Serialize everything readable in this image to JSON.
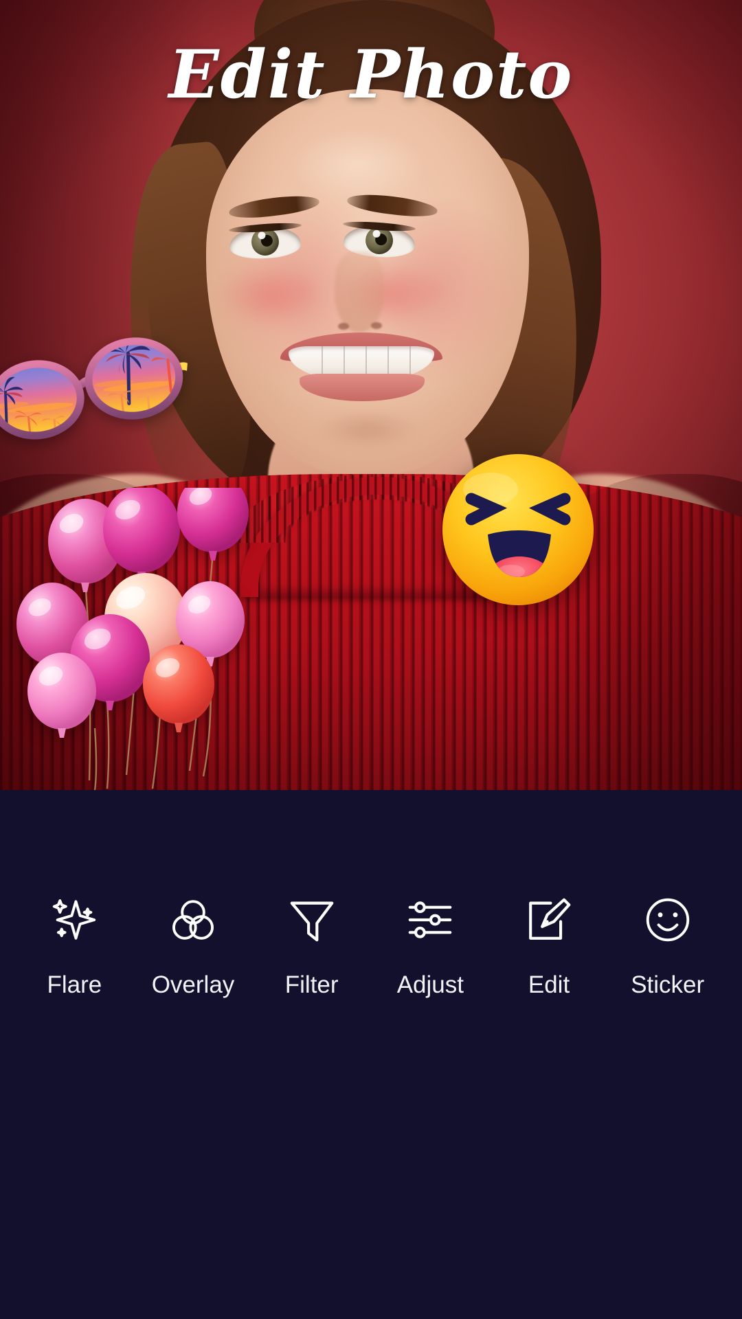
{
  "app": {
    "title": "Edit Photo",
    "background_color": "#12102c",
    "photo_backdrop_color": "#b33c40",
    "accent_color": "#ffffff"
  },
  "photo": {
    "description": "Smiling young woman with brown hair wearing a red ribbed knit sweater on a red studio backdrop",
    "stickers": [
      {
        "name": "sunglasses-sticker",
        "label": "Sunglasses",
        "type": "sunglasses",
        "position": "left"
      },
      {
        "name": "emoji-sticker",
        "label": "Laughing Emoji",
        "type": "emoji",
        "position": "right"
      },
      {
        "name": "balloons-sticker",
        "label": "Balloons",
        "type": "balloons",
        "position": "lower-left"
      }
    ]
  },
  "toolbar": {
    "items": [
      {
        "label": "Flare",
        "icon": "sparkle-icon"
      },
      {
        "label": "Overlay",
        "icon": "three-circles-icon"
      },
      {
        "label": "Filter",
        "icon": "funnel-icon"
      },
      {
        "label": "Adjust",
        "icon": "sliders-icon"
      },
      {
        "label": "Edit",
        "icon": "pencil-square-icon"
      },
      {
        "label": "Sticker",
        "icon": "smiley-face-icon"
      }
    ]
  }
}
